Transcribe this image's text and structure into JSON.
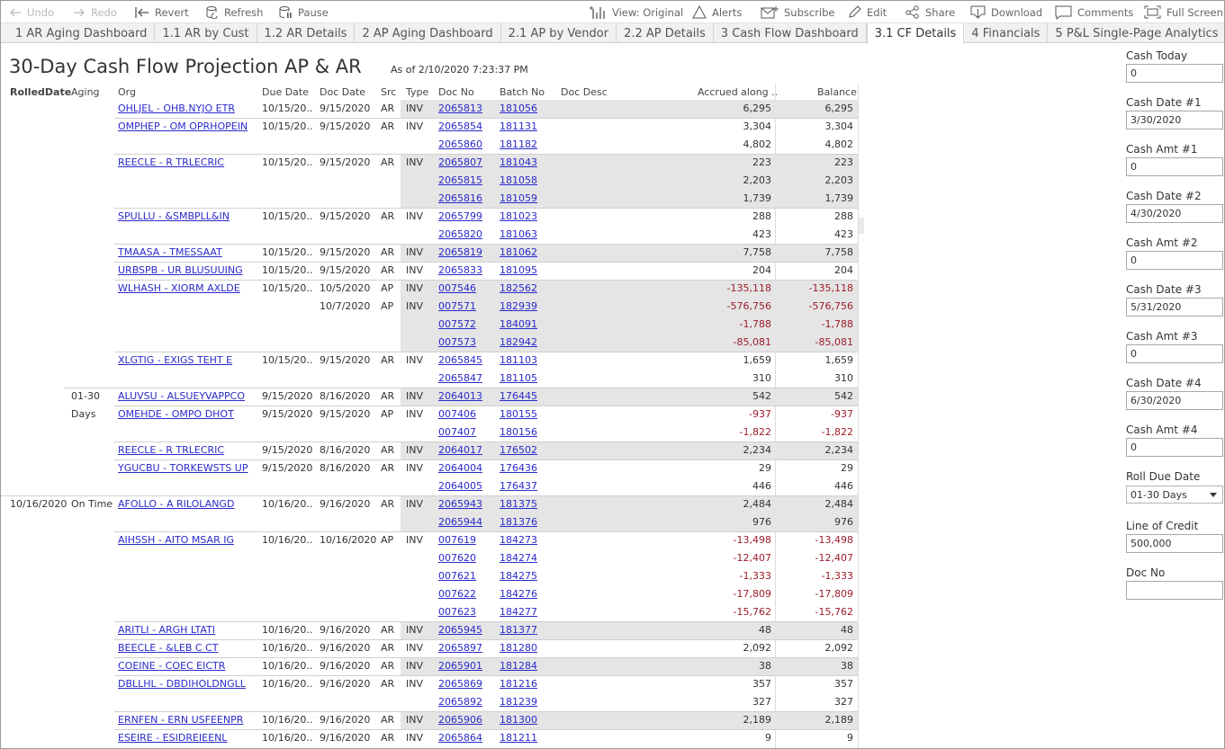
{
  "toolbar": {
    "undo": "Undo",
    "redo": "Redo",
    "revert": "Revert",
    "refresh": "Refresh",
    "pause": "Pause",
    "view": "View: Original",
    "alerts": "Alerts",
    "subscribe": "Subscribe",
    "edit": "Edit",
    "share": "Share",
    "download": "Download",
    "comments": "Comments",
    "fullscreen": "Full Screen"
  },
  "tabs": [
    "1 AR Aging Dashboard",
    "1.1 AR by Cust",
    "1.2 AR Details",
    "2 AP Aging Dashboard",
    "2.1 AP by Vendor",
    "2.2 AP Details",
    "3 Cash Flow Dashboard",
    "3.1 CF Details",
    "4 Financials",
    "5 P&L Single-Page Analytics"
  ],
  "active_tab": "3.1 CF Details",
  "title": "30-Day Cash Flow Projection AP & AR",
  "as_of": "As of 2/10/2020 7:23:37 PM",
  "columns": [
    "RolledDate",
    "Aging",
    "Org",
    "Due Date",
    "Doc Date",
    "Src",
    "Type",
    "Doc No",
    "Batch No",
    "Doc Desc",
    "Accrued along ..",
    "Balance"
  ],
  "rows": [
    {
      "rolled": "",
      "aging": "",
      "org": "OHLJEL - OHB.NYJO ETR",
      "due": "10/15/20..",
      "docdate": "9/15/2020",
      "src": "AR",
      "type": "INV",
      "docno": "2065813",
      "batch": "181056",
      "accrued": "6,295",
      "balance": "6,295",
      "neg": false,
      "stripe": true,
      "sep": false
    },
    {
      "rolled": "",
      "aging": "",
      "org": "OMPHEP - OM OPRHOPEIN",
      "due": "10/15/20..",
      "docdate": "9/15/2020",
      "src": "AR",
      "type": "INV",
      "docno": "2065854",
      "batch": "181131",
      "accrued": "3,304",
      "balance": "3,304",
      "neg": false,
      "stripe": false,
      "sep": true
    },
    {
      "rolled": "",
      "aging": "",
      "org": "",
      "due": "",
      "docdate": "",
      "src": "",
      "type": "",
      "docno": "2065860",
      "batch": "181182",
      "accrued": "4,802",
      "balance": "4,802",
      "neg": false,
      "stripe": false,
      "sep": false
    },
    {
      "rolled": "",
      "aging": "",
      "org": "REECLE - R TRLECRIC",
      "due": "10/15/20..",
      "docdate": "9/15/2020",
      "src": "AR",
      "type": "INV",
      "docno": "2065807",
      "batch": "181043",
      "accrued": "223",
      "balance": "223",
      "neg": false,
      "stripe": true,
      "sep": true
    },
    {
      "rolled": "",
      "aging": "",
      "org": "",
      "due": "",
      "docdate": "",
      "src": "",
      "type": "",
      "docno": "2065815",
      "batch": "181058",
      "accrued": "2,203",
      "balance": "2,203",
      "neg": false,
      "stripe": true,
      "sep": false
    },
    {
      "rolled": "",
      "aging": "",
      "org": "",
      "due": "",
      "docdate": "",
      "src": "",
      "type": "",
      "docno": "2065816",
      "batch": "181059",
      "accrued": "1,739",
      "balance": "1,739",
      "neg": false,
      "stripe": true,
      "sep": false
    },
    {
      "rolled": "",
      "aging": "",
      "org": "SPULLU - &SMBPLL&IN",
      "due": "10/15/20..",
      "docdate": "9/15/2020",
      "src": "AR",
      "type": "INV",
      "docno": "2065799",
      "batch": "181023",
      "accrued": "288",
      "balance": "288",
      "neg": false,
      "stripe": false,
      "sep": true
    },
    {
      "rolled": "",
      "aging": "",
      "org": "",
      "due": "",
      "docdate": "",
      "src": "",
      "type": "",
      "docno": "2065820",
      "batch": "181063",
      "accrued": "423",
      "balance": "423",
      "neg": false,
      "stripe": false,
      "sep": false
    },
    {
      "rolled": "",
      "aging": "",
      "org": "TMAASA - TMESSAAT",
      "due": "10/15/20..",
      "docdate": "9/15/2020",
      "src": "AR",
      "type": "INV",
      "docno": "2065819",
      "batch": "181062",
      "accrued": "7,758",
      "balance": "7,758",
      "neg": false,
      "stripe": true,
      "sep": true
    },
    {
      "rolled": "",
      "aging": "",
      "org": "URBSPB - UR BLUSUUING",
      "due": "10/15/20..",
      "docdate": "9/15/2020",
      "src": "AR",
      "type": "INV",
      "docno": "2065833",
      "batch": "181095",
      "accrued": "204",
      "balance": "204",
      "neg": false,
      "stripe": false,
      "sep": true
    },
    {
      "rolled": "",
      "aging": "",
      "org": "WLHASH - XIORM AXLDE",
      "due": "10/15/20..",
      "docdate": "10/5/2020",
      "src": "AP",
      "type": "INV",
      "docno": "007546",
      "batch": "182562",
      "accrued": "-135,118",
      "balance": "-135,118",
      "neg": true,
      "stripe": true,
      "sep": true
    },
    {
      "rolled": "",
      "aging": "",
      "org": "",
      "due": "",
      "docdate": "10/7/2020",
      "src": "AP",
      "type": "INV",
      "docno": "007571",
      "batch": "182939",
      "accrued": "-576,756",
      "balance": "-576,756",
      "neg": true,
      "stripe": true,
      "sep": false
    },
    {
      "rolled": "",
      "aging": "",
      "org": "",
      "due": "",
      "docdate": "",
      "src": "",
      "type": "",
      "docno": "007572",
      "batch": "184091",
      "accrued": "-1,788",
      "balance": "-1,788",
      "neg": true,
      "stripe": true,
      "sep": false
    },
    {
      "rolled": "",
      "aging": "",
      "org": "",
      "due": "",
      "docdate": "",
      "src": "",
      "type": "",
      "docno": "007573",
      "batch": "182942",
      "accrued": "-85,081",
      "balance": "-85,081",
      "neg": true,
      "stripe": true,
      "sep": false
    },
    {
      "rolled": "",
      "aging": "",
      "org": "XLGTIG - EXIGS TEHT E",
      "due": "10/15/20..",
      "docdate": "9/15/2020",
      "src": "AR",
      "type": "INV",
      "docno": "2065845",
      "batch": "181103",
      "accrued": "1,659",
      "balance": "1,659",
      "neg": false,
      "stripe": false,
      "sep": true
    },
    {
      "rolled": "",
      "aging": "",
      "org": "",
      "due": "",
      "docdate": "",
      "src": "",
      "type": "",
      "docno": "2065847",
      "batch": "181105",
      "accrued": "310",
      "balance": "310",
      "neg": false,
      "stripe": false,
      "sep": false
    },
    {
      "rolled": "",
      "aging": "01-30",
      "org": "ALUVSU - ALSUEYVAPPCO",
      "due": "9/15/2020",
      "docdate": "8/16/2020",
      "src": "AR",
      "type": "INV",
      "docno": "2064013",
      "batch": "176445",
      "accrued": "542",
      "balance": "542",
      "neg": false,
      "stripe": true,
      "sep": true
    },
    {
      "rolled": "",
      "aging": "Days",
      "org": "OMEHDE - OMPO DHOT",
      "due": "9/15/2020",
      "docdate": "9/15/2020",
      "src": "AP",
      "type": "INV",
      "docno": "007406",
      "batch": "180155",
      "accrued": "-937",
      "balance": "-937",
      "neg": true,
      "stripe": false,
      "sep": true
    },
    {
      "rolled": "",
      "aging": "",
      "org": "",
      "due": "",
      "docdate": "",
      "src": "",
      "type": "",
      "docno": "007407",
      "batch": "180156",
      "accrued": "-1,822",
      "balance": "-1,822",
      "neg": true,
      "stripe": false,
      "sep": false
    },
    {
      "rolled": "",
      "aging": "",
      "org": "REECLE - R TRLECRIC",
      "due": "9/15/2020",
      "docdate": "8/16/2020",
      "src": "AR",
      "type": "INV",
      "docno": "2064017",
      "batch": "176502",
      "accrued": "2,234",
      "balance": "2,234",
      "neg": false,
      "stripe": true,
      "sep": true
    },
    {
      "rolled": "",
      "aging": "",
      "org": "YGUCBU - TORKEWSTS UP",
      "due": "9/15/2020",
      "docdate": "8/16/2020",
      "src": "AR",
      "type": "INV",
      "docno": "2064004",
      "batch": "176436",
      "accrued": "29",
      "balance": "29",
      "neg": false,
      "stripe": false,
      "sep": true
    },
    {
      "rolled": "",
      "aging": "",
      "org": "",
      "due": "",
      "docdate": "",
      "src": "",
      "type": "",
      "docno": "2064005",
      "batch": "176437",
      "accrued": "446",
      "balance": "446",
      "neg": false,
      "stripe": false,
      "sep": false
    },
    {
      "rolled": "10/16/2020",
      "aging": "On Time",
      "org": "AFOLLO - A RILOLANGD",
      "due": "10/16/20..",
      "docdate": "9/16/2020",
      "src": "AR",
      "type": "INV",
      "docno": "2065943",
      "batch": "181375",
      "accrued": "2,484",
      "balance": "2,484",
      "neg": false,
      "stripe": true,
      "sep": true
    },
    {
      "rolled": "",
      "aging": "",
      "org": "",
      "due": "",
      "docdate": "",
      "src": "",
      "type": "",
      "docno": "2065944",
      "batch": "181376",
      "accrued": "976",
      "balance": "976",
      "neg": false,
      "stripe": true,
      "sep": false
    },
    {
      "rolled": "",
      "aging": "",
      "org": "AIHSSH - AITO MSAR IG",
      "due": "10/16/20..",
      "docdate": "10/16/2020",
      "src": "AP",
      "type": "INV",
      "docno": "007619",
      "batch": "184273",
      "accrued": "-13,498",
      "balance": "-13,498",
      "neg": true,
      "stripe": false,
      "sep": true
    },
    {
      "rolled": "",
      "aging": "",
      "org": "",
      "due": "",
      "docdate": "",
      "src": "",
      "type": "",
      "docno": "007620",
      "batch": "184274",
      "accrued": "-12,407",
      "balance": "-12,407",
      "neg": true,
      "stripe": false,
      "sep": false
    },
    {
      "rolled": "",
      "aging": "",
      "org": "",
      "due": "",
      "docdate": "",
      "src": "",
      "type": "",
      "docno": "007621",
      "batch": "184275",
      "accrued": "-1,333",
      "balance": "-1,333",
      "neg": true,
      "stripe": false,
      "sep": false
    },
    {
      "rolled": "",
      "aging": "",
      "org": "",
      "due": "",
      "docdate": "",
      "src": "",
      "type": "",
      "docno": "007622",
      "batch": "184276",
      "accrued": "-17,809",
      "balance": "-17,809",
      "neg": true,
      "stripe": false,
      "sep": false
    },
    {
      "rolled": "",
      "aging": "",
      "org": "",
      "due": "",
      "docdate": "",
      "src": "",
      "type": "",
      "docno": "007623",
      "batch": "184277",
      "accrued": "-15,762",
      "balance": "-15,762",
      "neg": true,
      "stripe": false,
      "sep": false
    },
    {
      "rolled": "",
      "aging": "",
      "org": "ARITLI - ARGH LTATI",
      "due": "10/16/20..",
      "docdate": "9/16/2020",
      "src": "AR",
      "type": "INV",
      "docno": "2065945",
      "batch": "181377",
      "accrued": "48",
      "balance": "48",
      "neg": false,
      "stripe": true,
      "sep": true
    },
    {
      "rolled": "",
      "aging": "",
      "org": "BEECLE - &LEB C CT",
      "due": "10/16/20..",
      "docdate": "9/16/2020",
      "src": "AR",
      "type": "INV",
      "docno": "2065897",
      "batch": "181280",
      "accrued": "2,092",
      "balance": "2,092",
      "neg": false,
      "stripe": false,
      "sep": true
    },
    {
      "rolled": "",
      "aging": "",
      "org": "COEINE - COEC EICTR",
      "due": "10/16/20..",
      "docdate": "9/16/2020",
      "src": "AR",
      "type": "INV",
      "docno": "2065901",
      "batch": "181284",
      "accrued": "38",
      "balance": "38",
      "neg": false,
      "stripe": true,
      "sep": true
    },
    {
      "rolled": "",
      "aging": "",
      "org": "DBLLHL - DBDIHOLDNGLL",
      "due": "10/16/20..",
      "docdate": "9/16/2020",
      "src": "AR",
      "type": "INV",
      "docno": "2065869",
      "batch": "181216",
      "accrued": "357",
      "balance": "357",
      "neg": false,
      "stripe": false,
      "sep": true
    },
    {
      "rolled": "",
      "aging": "",
      "org": "",
      "due": "",
      "docdate": "",
      "src": "",
      "type": "",
      "docno": "2065892",
      "batch": "181239",
      "accrued": "327",
      "balance": "327",
      "neg": false,
      "stripe": false,
      "sep": false
    },
    {
      "rolled": "",
      "aging": "",
      "org": "ERNFEN - ERN USFEENPR",
      "due": "10/16/20..",
      "docdate": "9/16/2020",
      "src": "AR",
      "type": "INV",
      "docno": "2065906",
      "batch": "181300",
      "accrued": "2,189",
      "balance": "2,189",
      "neg": false,
      "stripe": true,
      "sep": true
    },
    {
      "rolled": "",
      "aging": "",
      "org": "ESEIRE - ESIDREIEENL",
      "due": "10/16/20..",
      "docdate": "9/16/2020",
      "src": "AR",
      "type": "INV",
      "docno": "2065864",
      "batch": "181211",
      "accrued": "9",
      "balance": "9",
      "neg": false,
      "stripe": false,
      "sep": true
    }
  ],
  "panel": {
    "cash_today_label": "Cash Today",
    "cash_today": "0",
    "cash_date1_label": "Cash Date #1",
    "cash_date1": "3/30/2020",
    "cash_amt1_label": "Cash Amt #1",
    "cash_amt1": "0",
    "cash_date2_label": "Cash Date #2",
    "cash_date2": "4/30/2020",
    "cash_amt2_label": "Cash Amt #2",
    "cash_amt2": "0",
    "cash_date3_label": "Cash Date #3",
    "cash_date3": "5/31/2020",
    "cash_amt3_label": "Cash Amt #3",
    "cash_amt3": "0",
    "cash_date4_label": "Cash Date #4",
    "cash_date4": "6/30/2020",
    "cash_amt4_label": "Cash Amt #4",
    "cash_amt4": "0",
    "roll_due_label": "Roll Due Date",
    "roll_due": "01-30 Days",
    "loc_label": "Line of Credit",
    "loc": "500,000",
    "docno_label": "Doc No",
    "docno": ""
  },
  "colors": {
    "link": "#2a2acb",
    "negative": "#9d1d2b",
    "stripe": "#e5e5e5"
  }
}
